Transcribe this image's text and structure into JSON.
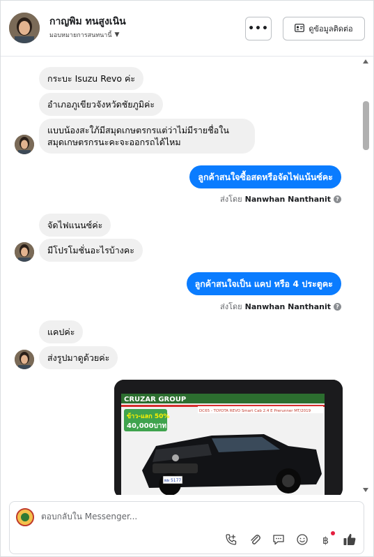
{
  "header": {
    "name": "กาญพิม ทนสูงเนิน",
    "sub": "มอบหมายการสนทนานี้",
    "more_label": "•••",
    "contact_label": "ดูข้อมูลติดต่อ"
  },
  "messages": {
    "in1": "กระบะ Isuzu Revo ค่ะ",
    "in2": "อำเภอภูเขียวจังหวัดชัยภูมิค่ะ",
    "in3_line1": "แบบน้องสะใภ้มีสมุดเกษตรกรแต่ว่าไม่มีรายชื่อใน",
    "in3_line2": "สมุดเกษตรกรนะคะจะออกรถได้ไหม",
    "out1": "ลูกค้าสนใจซื้อสดหรือจัดไฟแน้นซ์คะ",
    "sent_by_prefix1": "ส่งโดย",
    "sent_by_name1": "Nanwhan Nanthanit",
    "in4": "จัดไฟแนนซ์ค่ะ",
    "in5": "มีโปรโมชั่นอะไรบ้างคะ",
    "out2": "ลูกค้าสนใจเป็น แคป หรือ 4 ประตูคะ",
    "sent_by_prefix2": "ส่งโดย",
    "sent_by_name2": "Nanwhan Nanthanit",
    "in6": "แคปค่ะ",
    "in7": "ส่งรูปมาดูด้วยค่ะ"
  },
  "image_card": {
    "banner_text": "CRUZAR GROUP",
    "promo_line1": "ข้าว-แลก 50%",
    "promo_line2": "40,000บาท",
    "model_text": "DC65 - TOYOTA REVO Smart Cab 2.4 E Prerunner MT/2019",
    "plate": "ผผ 5177"
  },
  "composer": {
    "placeholder": "ตอบกลับใน Messenger..."
  },
  "icons": {
    "more": "more-icon",
    "contact": "contact-card-icon",
    "call": "call-add-icon",
    "attach": "attach-icon",
    "saved_replies": "chat-bubble-icon",
    "emoji": "emoji-icon",
    "payment": "baht-icon",
    "like": "thumbs-up-icon"
  },
  "colors": {
    "outgoing_bubble": "#0a7cff",
    "incoming_bubble": "#f0f0f0",
    "like": "#0a7cff",
    "notification_dot": "#e41e3f"
  }
}
